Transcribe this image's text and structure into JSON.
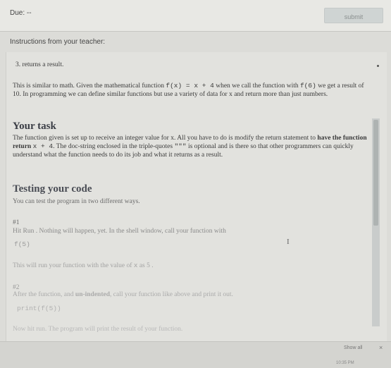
{
  "header": {
    "due_label": "Due: --",
    "submit_label": "submit"
  },
  "instructions_label": "Instructions from your teacher:",
  "content": {
    "step": "3. returns a result.",
    "intro": [
      "This is similar to math. Given the mathematical function ",
      "f(x) = x + 4",
      " when we call the function with ",
      "f(6)",
      " we get a result of 10. In programming we can define similar functions but use a variety of data for x and return more than just numbers."
    ],
    "task_heading": "Your task",
    "task_text_1": "The function given is set up to receive an integer value for x. All you have to do is modify the return statement to ",
    "task_bold": "have the function return ",
    "task_code": "x + 4",
    "task_text_2": ". The doc-string enclosed in the triple-quotes ",
    "task_quotes": "\"\"\"",
    "task_text_3": " is optional and is there so that other programmers can quickly understand what the function needs to do its job and what it returns as a result.",
    "testing_heading": "Testing your code",
    "testing_intro": "You can test the program in two different ways.",
    "test1_label": "#1",
    "test1_text": "Hit Run . Nothing will happen, yet. In the shell window, call your function with",
    "test1_code": "f(5)",
    "test1_result_a": "This will run your function with the value of ",
    "test1_result_x": "x",
    "test1_result_b": " as 5 .",
    "test2_label": "#2",
    "test2_text_a": "After the function, and ",
    "test2_bold": "un-indented",
    "test2_text_b": ", call your function like above and print it out.",
    "test2_code": "print(f(5))",
    "test2_result": "Now hit run. The program will print the result of your function."
  },
  "downloads": {
    "show_all": "Show all",
    "close": "×"
  },
  "clock": "10:35 PM",
  "colors": {
    "background": "#dcdcd8",
    "panel": "#e2e2de",
    "heading": "#3a3d45"
  },
  "icons": {
    "close": "close-icon",
    "text_cursor": "text-cursor-icon"
  }
}
